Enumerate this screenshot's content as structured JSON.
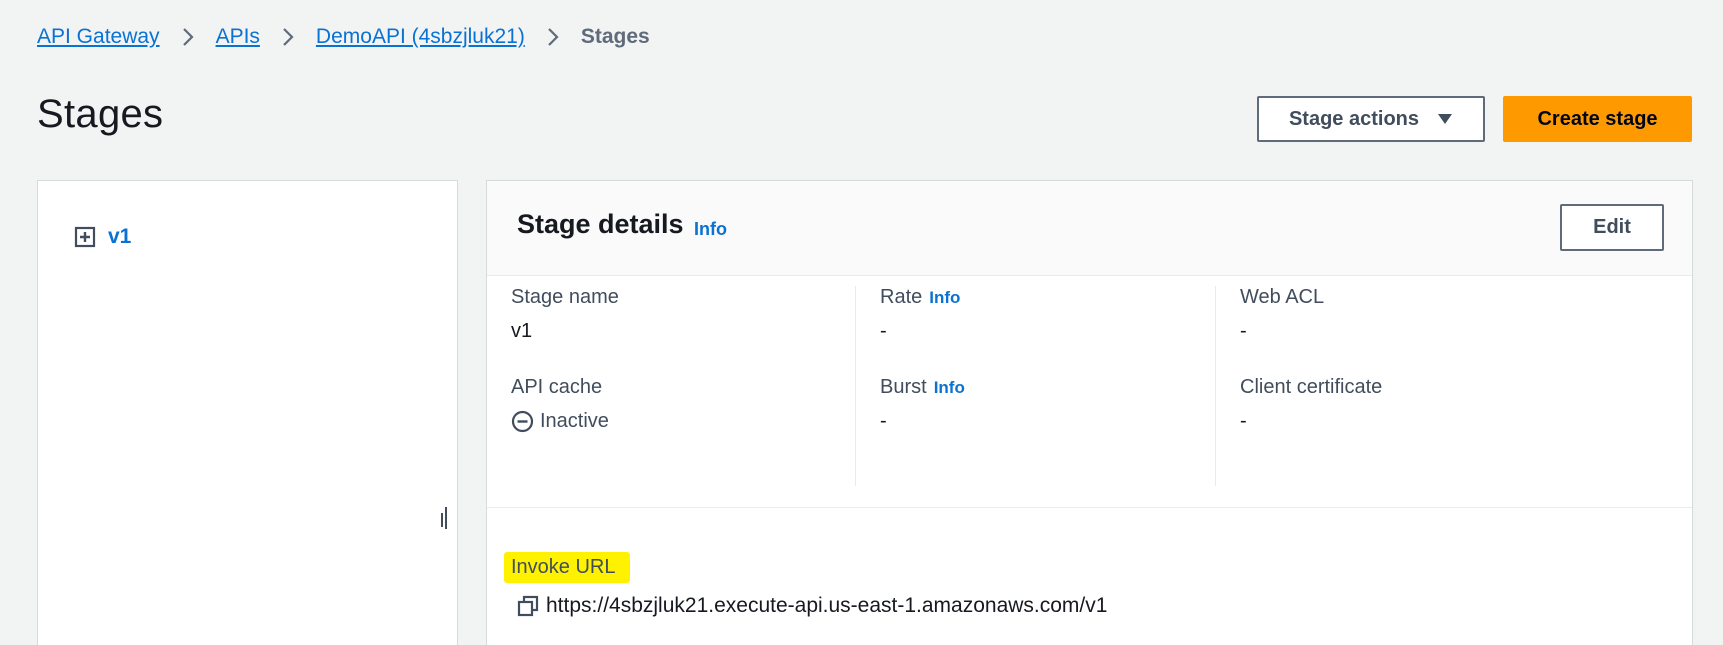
{
  "breadcrumb": {
    "items": [
      "API Gateway",
      "APIs",
      "DemoAPI (4sbzjluk21)"
    ],
    "current": "Stages"
  },
  "page": {
    "title": "Stages"
  },
  "header": {
    "stage_actions_label": "Stage actions",
    "create_stage_label": "Create stage"
  },
  "tree": {
    "items": [
      {
        "label": "v1",
        "icon": "expand-plus-icon"
      }
    ]
  },
  "details": {
    "title": "Stage details",
    "info_label": "Info",
    "edit_label": "Edit",
    "fields": {
      "stage_name": {
        "label": "Stage name",
        "value": "v1"
      },
      "api_cache": {
        "label": "API cache",
        "value": "Inactive",
        "icon": "inactive-status-icon"
      },
      "rate": {
        "label": "Rate",
        "info": "Info",
        "value": "-"
      },
      "burst": {
        "label": "Burst",
        "info": "Info",
        "value": "-"
      },
      "web_acl": {
        "label": "Web ACL",
        "value": "-"
      },
      "client_certificate": {
        "label": "Client certificate",
        "value": "-"
      }
    },
    "invoke": {
      "label": "Invoke URL",
      "url": "https://4sbzjluk21.execute-api.us-east-1.amazonaws.com/v1",
      "highlight_color": "#fff200"
    }
  },
  "colors": {
    "link": "#0972d3",
    "primary_button": "#ff9900",
    "background": "#f2f3f3"
  }
}
